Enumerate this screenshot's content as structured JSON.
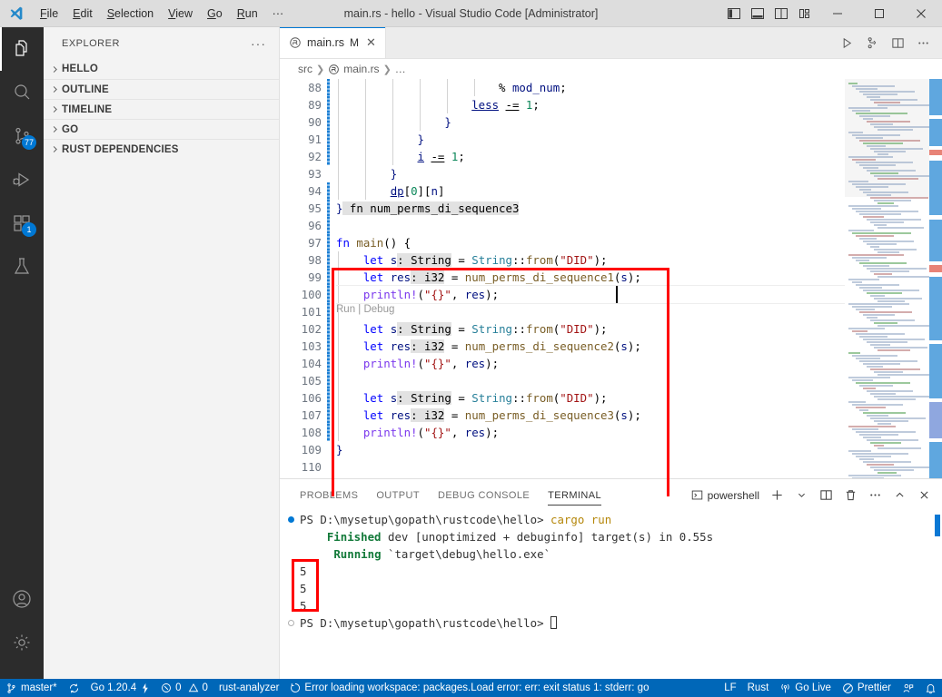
{
  "window": {
    "title": "main.rs - hello - Visual Studio Code [Administrator]",
    "menu": [
      "File",
      "Edit",
      "Selection",
      "View",
      "Go",
      "Run",
      "…"
    ],
    "layout_buttons": [
      "toggle-primary-sidebar",
      "toggle-panel",
      "toggle-secondary-sidebar",
      "customize-layout"
    ],
    "controls": [
      "minimize",
      "maximize",
      "close"
    ]
  },
  "activitybar": {
    "items": [
      {
        "name": "explorer",
        "badge": ""
      },
      {
        "name": "search",
        "badge": ""
      },
      {
        "name": "source-control",
        "badge": "77"
      },
      {
        "name": "run-and-debug",
        "badge": ""
      },
      {
        "name": "extensions",
        "badge": "1"
      },
      {
        "name": "testing",
        "badge": ""
      }
    ],
    "bottom": [
      {
        "name": "accounts"
      },
      {
        "name": "manage-settings"
      }
    ]
  },
  "sidebar": {
    "title": "EXPLORER",
    "more_actions": "···",
    "sections": [
      {
        "label": "HELLO",
        "expanded": false
      },
      {
        "label": "OUTLINE",
        "expanded": false
      },
      {
        "label": "TIMELINE",
        "expanded": false
      },
      {
        "label": "GO",
        "expanded": false
      },
      {
        "label": "RUST DEPENDENCIES",
        "expanded": false
      }
    ]
  },
  "editor": {
    "tab": {
      "label": "main.rs",
      "modified_badge": "M",
      "close": "✕",
      "icon": "rust-icon"
    },
    "actions": [
      "run-icon",
      "source-control-graph-icon",
      "split-editor-icon",
      "more-actions-icon"
    ],
    "breadcrumb": [
      "src",
      "main.rs",
      "…"
    ],
    "codelens": "Run | Debug",
    "lines": [
      {
        "num": "88",
        "dirty": true,
        "indents": [
          0,
          1,
          2,
          3,
          4,
          5
        ],
        "tokens": [
          {
            "t": "                        % ",
            "c": "op"
          },
          {
            "t": "mod_num",
            "c": "var"
          },
          {
            "t": ";",
            "c": "punc"
          }
        ]
      },
      {
        "num": "89",
        "dirty": true,
        "indents": [
          0,
          1,
          2,
          3,
          4
        ],
        "tokens": [
          {
            "t": "                    ",
            "c": "op"
          },
          {
            "t": "less",
            "c": "var uline"
          },
          {
            "t": " ",
            "c": "op"
          },
          {
            "t": "-=",
            "c": "op uline"
          },
          {
            "t": " ",
            "c": "op"
          },
          {
            "t": "1",
            "c": "num"
          },
          {
            "t": ";",
            "c": "punc"
          }
        ]
      },
      {
        "num": "90",
        "dirty": true,
        "indents": [
          0,
          1,
          2,
          3
        ],
        "tokens": [
          {
            "t": "                ",
            "c": "op"
          },
          {
            "t": "}",
            "c": "var"
          }
        ]
      },
      {
        "num": "91",
        "dirty": true,
        "indents": [
          0,
          1,
          2
        ],
        "tokens": [
          {
            "t": "            ",
            "c": "op"
          },
          {
            "t": "}",
            "c": "var"
          }
        ]
      },
      {
        "num": "92",
        "dirty": true,
        "indents": [
          0,
          1,
          2
        ],
        "tokens": [
          {
            "t": "            ",
            "c": "op"
          },
          {
            "t": "i",
            "c": "var uline"
          },
          {
            "t": " ",
            "c": "op"
          },
          {
            "t": "-=",
            "c": "op uline"
          },
          {
            "t": " ",
            "c": "op"
          },
          {
            "t": "1",
            "c": "num"
          },
          {
            "t": ";",
            "c": "punc"
          }
        ]
      },
      {
        "num": "93",
        "dirty": false,
        "indents": [
          0,
          1
        ],
        "tokens": [
          {
            "t": "        ",
            "c": "op"
          },
          {
            "t": "}",
            "c": "var"
          }
        ]
      },
      {
        "num": "94",
        "dirty": true,
        "indents": [
          0,
          1
        ],
        "tokens": [
          {
            "t": "        ",
            "c": "op"
          },
          {
            "t": "dp",
            "c": "var uline"
          },
          {
            "t": "[",
            "c": "punc"
          },
          {
            "t": "0",
            "c": "num"
          },
          {
            "t": "][",
            "c": "punc"
          },
          {
            "t": "n",
            "c": "var"
          },
          {
            "t": "]",
            "c": "punc"
          }
        ]
      },
      {
        "num": "95",
        "dirty": true,
        "indents": [],
        "tokens": [
          {
            "t": "}",
            "c": "var"
          },
          {
            "t": " fn num_perms_di_sequence3",
            "c": "hl"
          }
        ]
      },
      {
        "num": "96",
        "dirty": true,
        "indents": [],
        "tokens": []
      },
      {
        "num": "97",
        "dirty": true,
        "indents": [],
        "tokens": [
          {
            "t": "fn",
            "c": "kw"
          },
          {
            "t": " ",
            "c": "op"
          },
          {
            "t": "main",
            "c": "fnname"
          },
          {
            "t": "() {",
            "c": "punc"
          }
        ]
      },
      {
        "num": "98",
        "dirty": true,
        "indents": [
          0
        ],
        "tokens": [
          {
            "t": "    ",
            "c": "op"
          },
          {
            "t": "let",
            "c": "kw"
          },
          {
            "t": " ",
            "c": "op"
          },
          {
            "t": "s",
            "c": "var"
          },
          {
            "t": ": String",
            "c": "hint"
          },
          {
            "t": " = ",
            "c": "op"
          },
          {
            "t": "String",
            "c": "type"
          },
          {
            "t": "::",
            "c": "punc"
          },
          {
            "t": "from",
            "c": "fnname"
          },
          {
            "t": "(",
            "c": "punc"
          },
          {
            "t": "\"DID\"",
            "c": "str"
          },
          {
            "t": ");",
            "c": "punc"
          }
        ]
      },
      {
        "num": "99",
        "dirty": true,
        "indents": [
          0
        ],
        "tokens": [
          {
            "t": "    ",
            "c": "op"
          },
          {
            "t": "let",
            "c": "kw"
          },
          {
            "t": " ",
            "c": "op"
          },
          {
            "t": "res",
            "c": "var"
          },
          {
            "t": ": i32",
            "c": "hint"
          },
          {
            "t": " = ",
            "c": "op"
          },
          {
            "t": "num_perms_di_sequence1",
            "c": "fnname"
          },
          {
            "t": "(",
            "c": "punc"
          },
          {
            "t": "s",
            "c": "var"
          },
          {
            "t": ");",
            "c": "punc"
          }
        ]
      },
      {
        "num": "100",
        "dirty": true,
        "indents": [
          0
        ],
        "tokens": [
          {
            "t": "    ",
            "c": "op"
          },
          {
            "t": "println!",
            "c": "macro"
          },
          {
            "t": "(",
            "c": "punc"
          },
          {
            "t": "\"{}\"",
            "c": "str"
          },
          {
            "t": ", ",
            "c": "punc"
          },
          {
            "t": "res",
            "c": "var"
          },
          {
            "t": ");",
            "c": "punc"
          }
        ]
      },
      {
        "num": "101",
        "dirty": true,
        "indents": [
          0
        ],
        "tokens": []
      },
      {
        "num": "102",
        "dirty": true,
        "indents": [
          0
        ],
        "tokens": [
          {
            "t": "    ",
            "c": "op"
          },
          {
            "t": "let",
            "c": "kw"
          },
          {
            "t": " ",
            "c": "op"
          },
          {
            "t": "s",
            "c": "var"
          },
          {
            "t": ": String",
            "c": "hint"
          },
          {
            "t": " = ",
            "c": "op"
          },
          {
            "t": "String",
            "c": "type"
          },
          {
            "t": "::",
            "c": "punc"
          },
          {
            "t": "from",
            "c": "fnname"
          },
          {
            "t": "(",
            "c": "punc"
          },
          {
            "t": "\"DID\"",
            "c": "str"
          },
          {
            "t": ");",
            "c": "punc"
          }
        ]
      },
      {
        "num": "103",
        "dirty": true,
        "indents": [
          0
        ],
        "tokens": [
          {
            "t": "    ",
            "c": "op"
          },
          {
            "t": "let",
            "c": "kw"
          },
          {
            "t": " ",
            "c": "op"
          },
          {
            "t": "res",
            "c": "var"
          },
          {
            "t": ": i32",
            "c": "hint"
          },
          {
            "t": " = ",
            "c": "op"
          },
          {
            "t": "num_perms_di_sequence2",
            "c": "fnname"
          },
          {
            "t": "(",
            "c": "punc"
          },
          {
            "t": "s",
            "c": "var"
          },
          {
            "t": ");",
            "c": "punc"
          }
        ]
      },
      {
        "num": "104",
        "dirty": true,
        "indents": [
          0
        ],
        "tokens": [
          {
            "t": "    ",
            "c": "op"
          },
          {
            "t": "println!",
            "c": "macro"
          },
          {
            "t": "(",
            "c": "punc"
          },
          {
            "t": "\"{}\"",
            "c": "str"
          },
          {
            "t": ", ",
            "c": "punc"
          },
          {
            "t": "res",
            "c": "var"
          },
          {
            "t": ");",
            "c": "punc"
          }
        ]
      },
      {
        "num": "105",
        "dirty": true,
        "indents": [
          0
        ],
        "tokens": []
      },
      {
        "num": "106",
        "dirty": true,
        "indents": [
          0
        ],
        "tokens": [
          {
            "t": "    ",
            "c": "op"
          },
          {
            "t": "let",
            "c": "kw"
          },
          {
            "t": " ",
            "c": "op"
          },
          {
            "t": "s",
            "c": "var"
          },
          {
            "t": ": String",
            "c": "hint"
          },
          {
            "t": " = ",
            "c": "op"
          },
          {
            "t": "String",
            "c": "type"
          },
          {
            "t": "::",
            "c": "punc"
          },
          {
            "t": "from",
            "c": "fnname"
          },
          {
            "t": "(",
            "c": "punc"
          },
          {
            "t": "\"DID\"",
            "c": "str"
          },
          {
            "t": ");",
            "c": "punc"
          }
        ]
      },
      {
        "num": "107",
        "dirty": true,
        "indents": [
          0
        ],
        "tokens": [
          {
            "t": "    ",
            "c": "op"
          },
          {
            "t": "let",
            "c": "kw"
          },
          {
            "t": " ",
            "c": "op"
          },
          {
            "t": "res",
            "c": "var"
          },
          {
            "t": ": i32",
            "c": "hint"
          },
          {
            "t": " = ",
            "c": "op"
          },
          {
            "t": "num_perms_di_sequence3",
            "c": "fnname"
          },
          {
            "t": "(",
            "c": "punc"
          },
          {
            "t": "s",
            "c": "var"
          },
          {
            "t": ");",
            "c": "punc"
          }
        ]
      },
      {
        "num": "108",
        "dirty": true,
        "indents": [
          0
        ],
        "tokens": [
          {
            "t": "    ",
            "c": "op"
          },
          {
            "t": "println!",
            "c": "macro"
          },
          {
            "t": "(",
            "c": "punc"
          },
          {
            "t": "\"{}\"",
            "c": "str"
          },
          {
            "t": ", ",
            "c": "punc"
          },
          {
            "t": "res",
            "c": "var"
          },
          {
            "t": ");",
            "c": "punc"
          }
        ]
      },
      {
        "num": "109",
        "dirty": false,
        "indents": [],
        "tokens": [
          {
            "t": "}",
            "c": "var"
          }
        ]
      },
      {
        "num": "110",
        "dirty": false,
        "indents": [],
        "tokens": []
      }
    ]
  },
  "panel": {
    "tabs": [
      {
        "label": "PROBLEMS",
        "active": false
      },
      {
        "label": "OUTPUT",
        "active": false
      },
      {
        "label": "DEBUG CONSOLE",
        "active": false
      },
      {
        "label": "TERMINAL",
        "active": true
      }
    ],
    "terminal_name": "powershell",
    "actions": [
      "new-terminal-icon",
      "terminal-dropdown-icon",
      "split-terminal-icon",
      "kill-terminal-icon",
      "more-actions-icon",
      "collapse-panel-icon",
      "close-panel-icon"
    ],
    "terminal_lines": [
      {
        "marker": "blue",
        "parts": [
          {
            "t": "PS D:\\mysetup\\gopath\\rustcode\\hello> ",
            "c": "t-plain"
          },
          {
            "t": "cargo run",
            "c": "t-cmd"
          }
        ]
      },
      {
        "marker": "",
        "parts": [
          {
            "t": "    ",
            "c": "t-plain"
          },
          {
            "t": "Finished",
            "c": "t-green"
          },
          {
            "t": " dev [unoptimized + debuginfo] target(s) in 0.55s",
            "c": "t-plain"
          }
        ]
      },
      {
        "marker": "",
        "parts": [
          {
            "t": "     ",
            "c": "t-plain"
          },
          {
            "t": "Running",
            "c": "t-green"
          },
          {
            "t": " `target\\debug\\hello.exe`",
            "c": "t-plain"
          }
        ]
      },
      {
        "marker": "",
        "parts": [
          {
            "t": "5",
            "c": "t-plain"
          }
        ]
      },
      {
        "marker": "",
        "parts": [
          {
            "t": "5",
            "c": "t-plain"
          }
        ]
      },
      {
        "marker": "",
        "parts": [
          {
            "t": "5",
            "c": "t-plain"
          }
        ]
      },
      {
        "marker": "gray",
        "parts": [
          {
            "t": "PS D:\\mysetup\\gopath\\rustcode\\hello> ",
            "c": "t-plain"
          }
        ],
        "cursor": true
      }
    ]
  },
  "statusbar": {
    "left": [
      {
        "icon": "source-control-branch-icon",
        "label": "master*"
      },
      {
        "icon": "sync-icon",
        "label": ""
      },
      {
        "icon": "",
        "label": "Go 1.20.4"
      },
      {
        "icon": "go-lightning-icon",
        "label": ""
      },
      {
        "icon": "error-icon",
        "label": "0"
      },
      {
        "icon": "warning-icon",
        "label": "0"
      },
      {
        "icon": "",
        "label": "rust-analyzer"
      },
      {
        "icon": "loading-icon",
        "label": "Error loading workspace: packages.Load error: err: exit status 1: stderr: go"
      }
    ],
    "right": [
      {
        "icon": "",
        "label": "LF"
      },
      {
        "icon": "",
        "label": "Rust"
      },
      {
        "icon": "broadcast-icon",
        "label": "Go Live"
      },
      {
        "icon": "prettier-icon",
        "label": "Prettier"
      },
      {
        "icon": "remote-feedback-icon",
        "label": ""
      },
      {
        "icon": "bell-icon",
        "label": ""
      }
    ]
  },
  "annotations": {
    "code_highlight_box": "red-rect-around-main-fn",
    "terminal_highlight_box": "red-rect-around-output-555"
  }
}
